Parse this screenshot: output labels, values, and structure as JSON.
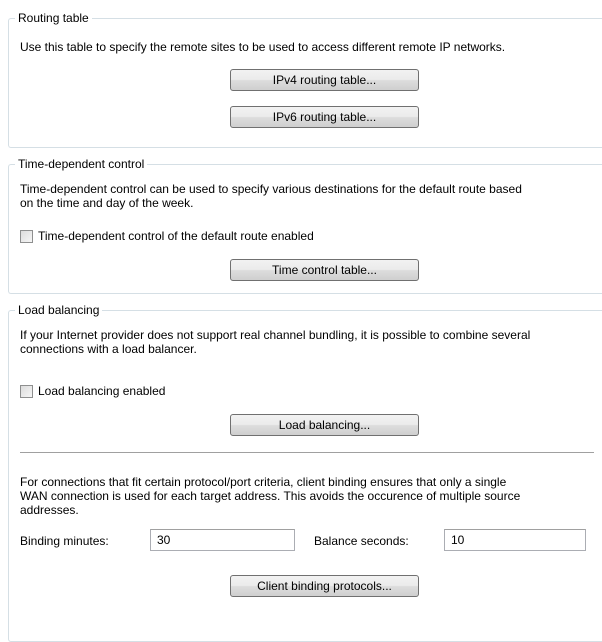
{
  "routing": {
    "title": "Routing table",
    "description": "Use this table to specify the remote sites to be used to access different remote IP networks.",
    "ipv4_button": "IPv4 routing table...",
    "ipv6_button": "IPv6 routing table..."
  },
  "time_control": {
    "title": "Time-dependent control",
    "description_line1": "Time-dependent control can be used to specify various destinations for the default route based",
    "description_line2": "on the time and day of the week.",
    "checkbox_label": "Time-dependent control of the default route enabled",
    "checkbox_checked": false,
    "button": "Time control table..."
  },
  "load_balancing": {
    "title": "Load balancing",
    "description_line1": "If your Internet provider does not support real channel bundling, it is possible to combine several",
    "description_line2": "connections with a load balancer.",
    "checkbox_label": "Load balancing enabled",
    "checkbox_checked": false,
    "button": "Load balancing...",
    "binding_text_line1": "For connections that fit certain protocol/port criteria, client binding ensures that only a single",
    "binding_text_line2": "WAN connection is used for each target address. This avoids the occurence of multiple source",
    "binding_text_line3": "addresses.",
    "binding_minutes_label": "Binding minutes:",
    "binding_minutes_value": "30",
    "balance_seconds_label": "Balance seconds:",
    "balance_seconds_value": "10",
    "client_binding_button": "Client binding protocols..."
  }
}
